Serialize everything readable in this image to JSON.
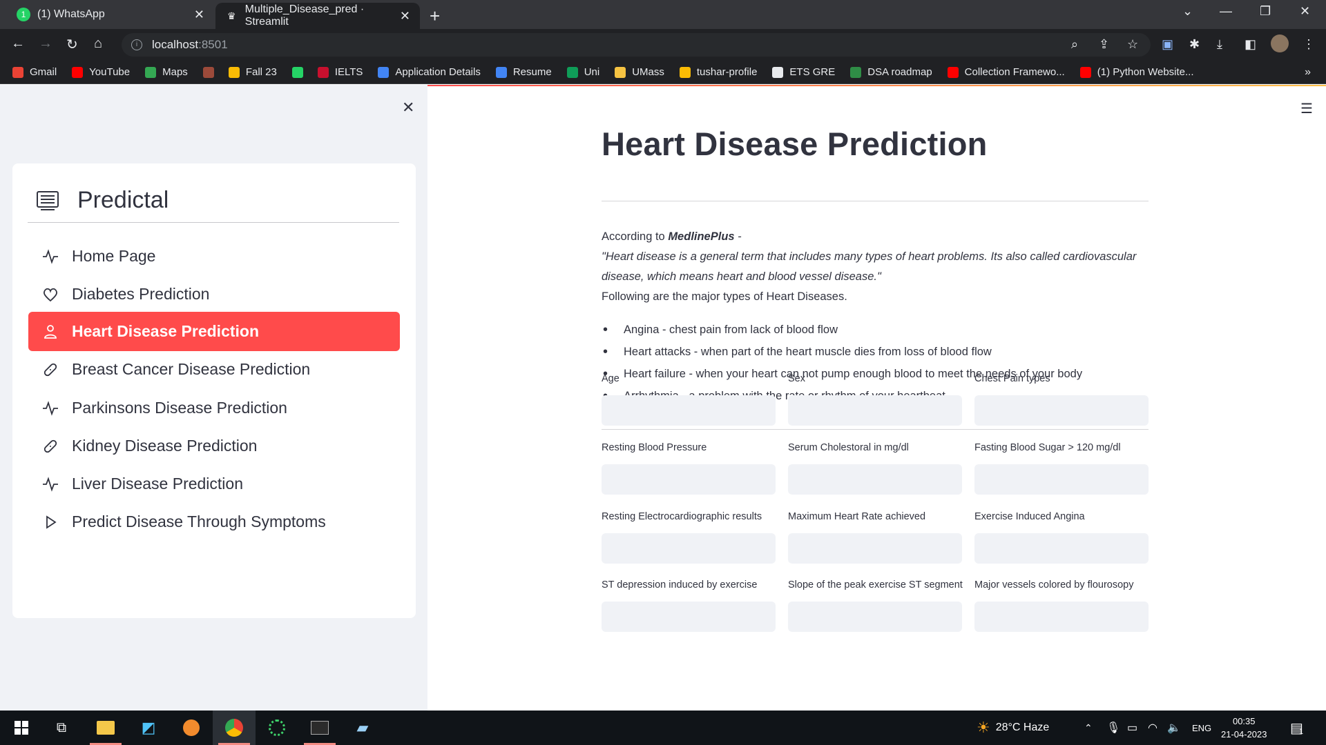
{
  "browser": {
    "tabs": [
      {
        "label": "(1) WhatsApp",
        "active": false
      },
      {
        "label": "Multiple_Disease_pred · Streamlit",
        "active": true
      }
    ],
    "url_host": "localhost",
    "url_port": ":8501",
    "bookmarks": [
      {
        "label": "Gmail",
        "color": "#ea4335"
      },
      {
        "label": "YouTube",
        "color": "#ff0000"
      },
      {
        "label": "Maps",
        "color": "#34a853"
      },
      {
        "label": "",
        "color": "#9c4a3a"
      },
      {
        "label": "Fall 23",
        "color": "#fbbc04"
      },
      {
        "label": "",
        "color": "#25d366"
      },
      {
        "label": "IELTS",
        "color": "#c8102e"
      },
      {
        "label": "Application Details",
        "color": "#4285f4"
      },
      {
        "label": "Resume",
        "color": "#4285f4"
      },
      {
        "label": "Uni",
        "color": "#0f9d58"
      },
      {
        "label": "UMass",
        "color": "#f6c342"
      },
      {
        "label": "tushar-profile",
        "color": "#fbbc04"
      },
      {
        "label": "ETS GRE",
        "color": "#e8eaed"
      },
      {
        "label": "DSA roadmap",
        "color": "#2f8d46"
      },
      {
        "label": "Collection Framewo...",
        "color": "#ff0000"
      },
      {
        "label": "(1) Python Website...",
        "color": "#ff0000"
      }
    ]
  },
  "sidebar": {
    "title": "Predictal",
    "items": [
      {
        "label": "Home Page",
        "icon": "activity-icon"
      },
      {
        "label": "Diabetes Prediction",
        "icon": "heart-icon"
      },
      {
        "label": "Heart Disease Prediction",
        "icon": "person-icon",
        "active": true
      },
      {
        "label": "Breast Cancer Disease Prediction",
        "icon": "bandaid-icon"
      },
      {
        "label": "Parkinsons Disease Prediction",
        "icon": "activity-icon"
      },
      {
        "label": "Kidney Disease Prediction",
        "icon": "bandaid-icon"
      },
      {
        "label": "Liver Disease Prediction",
        "icon": "activity-icon"
      },
      {
        "label": "Predict Disease Through Symptoms",
        "icon": "play-icon"
      }
    ]
  },
  "main": {
    "title": "Heart Disease Prediction",
    "intro_prefix": "According to ",
    "intro_source": "MedlinePlus",
    "intro_suffix": " -",
    "quote": "\"Heart disease is a general term that includes many types of heart problems. Its also called cardiovascular disease, which means heart and blood vessel disease.\"",
    "following": "Following are the major types of Heart Diseases.",
    "bullets": [
      "Angina - chest pain from lack of blood flow",
      "Heart attacks - when part of the heart muscle dies from loss of blood flow",
      "Heart failure - when your heart can not pump enough blood to meet the needs of your body",
      "Arrhythmia - a problem with the rate or rhythm of your heartbeat"
    ],
    "fields": [
      {
        "label": "Age",
        "value": ""
      },
      {
        "label": "Sex",
        "value": ""
      },
      {
        "label": "Chest Pain types",
        "value": ""
      },
      {
        "label": "Resting Blood Pressure",
        "value": ""
      },
      {
        "label": "Serum Cholestoral in mg/dl",
        "value": ""
      },
      {
        "label": "Fasting Blood Sugar > 120 mg/dl",
        "value": ""
      },
      {
        "label": "Resting Electrocardiographic results",
        "value": ""
      },
      {
        "label": "Maximum Heart Rate achieved",
        "value": ""
      },
      {
        "label": "Exercise Induced Angina",
        "value": ""
      },
      {
        "label": "ST depression induced by exercise",
        "value": ""
      },
      {
        "label": "Slope of the peak exercise ST segment",
        "value": ""
      },
      {
        "label": "Major vessels colored by flourosopy",
        "value": ""
      }
    ]
  },
  "taskbar": {
    "weather": "28°C  Haze",
    "lang": "ENG",
    "time": "00:35",
    "date": "21-04-2023",
    "notif_count": "1"
  },
  "colors": {
    "accent": "#ff4b4b",
    "sidebar_bg": "#f0f2f6",
    "input_bg": "#f0f2f6",
    "text": "#31333f"
  }
}
